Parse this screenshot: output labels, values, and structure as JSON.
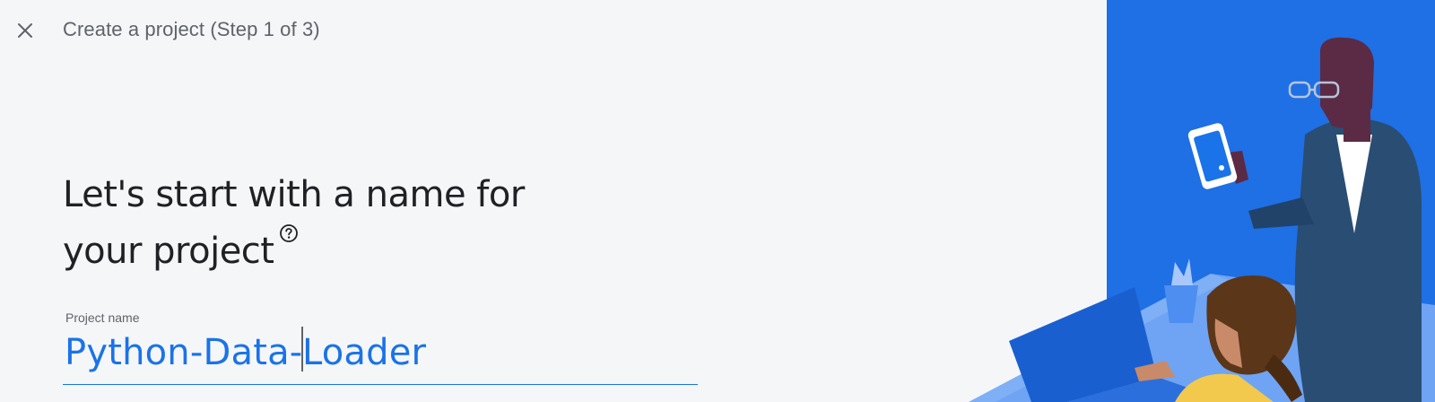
{
  "header": {
    "close_icon": "close-icon",
    "title": "Create a project (Step 1 of 3)"
  },
  "main": {
    "heading_line1": "Let's start with a name for",
    "heading_line2": "your project",
    "help_icon": "help-circle-icon",
    "project_name_label": "Project name",
    "project_name_value_before_cursor": "Python-Data-",
    "project_name_value_after_cursor": "Loader"
  },
  "illustration": {
    "name": "people-with-phone-and-laptop-illustration",
    "background_color": "#1f6fe5"
  },
  "colors": {
    "accent": "#1a73e8",
    "page_background": "#f5f6f8",
    "heading_text": "#202124",
    "secondary_text": "#5f6368"
  }
}
